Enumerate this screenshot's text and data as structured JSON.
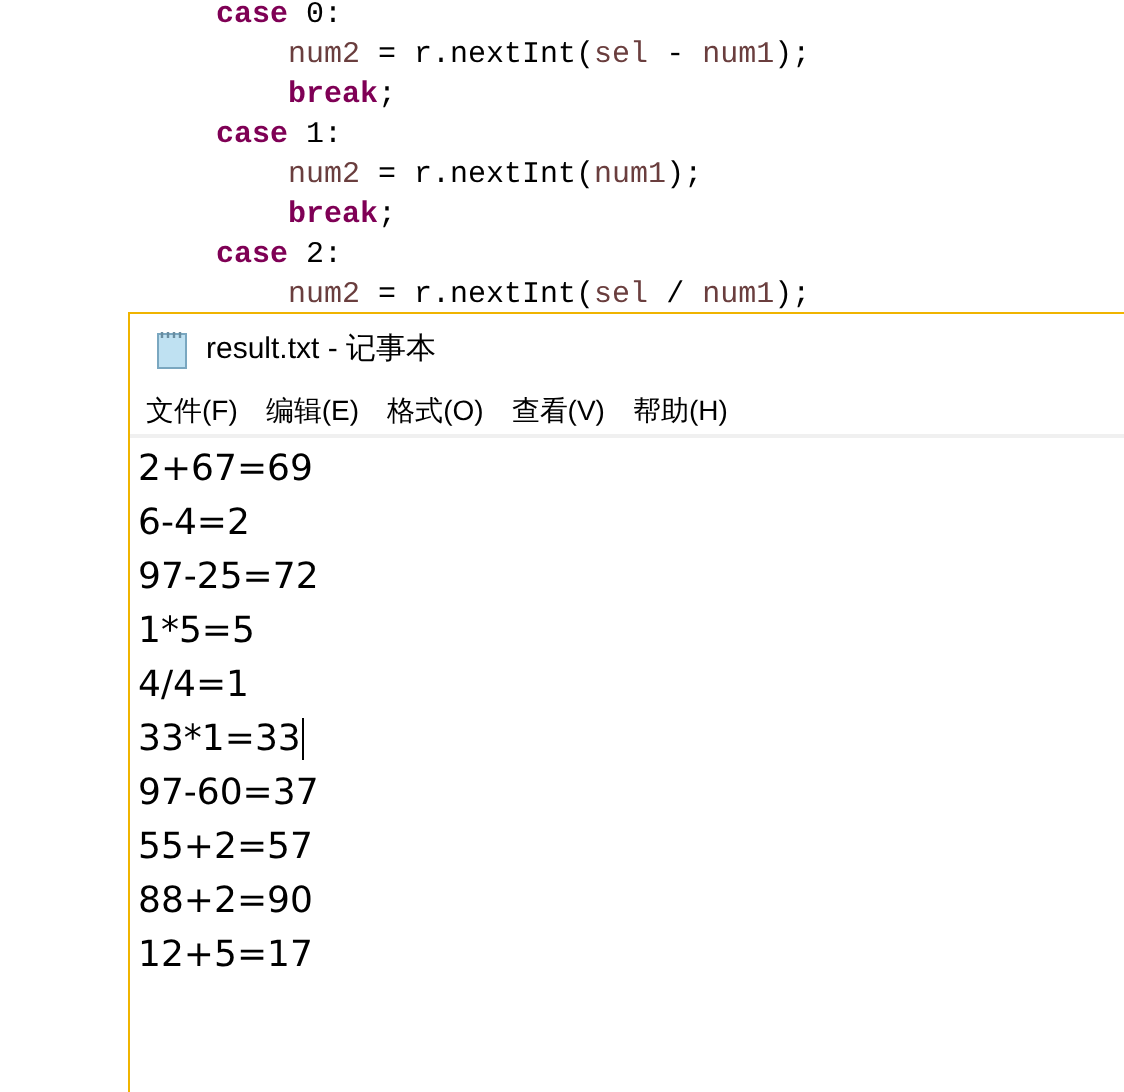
{
  "code": {
    "lines": [
      {
        "kind": "label",
        "tokens": [
          {
            "kind": "keyword",
            "text": "case"
          },
          {
            "kind": "plain",
            "text": " 0:"
          }
        ]
      },
      {
        "kind": "body",
        "tokens": [
          {
            "kind": "var",
            "text": "num2"
          },
          {
            "kind": "plain",
            "text": " = r.nextInt("
          },
          {
            "kind": "var",
            "text": "sel"
          },
          {
            "kind": "plain",
            "text": " - "
          },
          {
            "kind": "var",
            "text": "num1"
          },
          {
            "kind": "plain",
            "text": ");"
          }
        ]
      },
      {
        "kind": "body",
        "tokens": [
          {
            "kind": "keyword",
            "text": "break"
          },
          {
            "kind": "plain",
            "text": ";"
          }
        ]
      },
      {
        "kind": "label",
        "tokens": [
          {
            "kind": "keyword",
            "text": "case"
          },
          {
            "kind": "plain",
            "text": " 1:"
          }
        ]
      },
      {
        "kind": "body",
        "tokens": [
          {
            "kind": "var",
            "text": "num2"
          },
          {
            "kind": "plain",
            "text": " = r.nextInt("
          },
          {
            "kind": "var",
            "text": "num1"
          },
          {
            "kind": "plain",
            "text": ");"
          }
        ]
      },
      {
        "kind": "body",
        "tokens": [
          {
            "kind": "keyword",
            "text": "break"
          },
          {
            "kind": "plain",
            "text": ";"
          }
        ]
      },
      {
        "kind": "label",
        "tokens": [
          {
            "kind": "keyword",
            "text": "case"
          },
          {
            "kind": "plain",
            "text": " 2:"
          }
        ]
      },
      {
        "kind": "body",
        "tokens": [
          {
            "kind": "var",
            "text": "num2"
          },
          {
            "kind": "plain",
            "text": " = r.nextInt("
          },
          {
            "kind": "var",
            "text": "sel"
          },
          {
            "kind": "plain",
            "text": " / "
          },
          {
            "kind": "var",
            "text": "num1"
          },
          {
            "kind": "plain",
            "text": ");"
          }
        ]
      }
    ]
  },
  "notepad": {
    "title": "result.txt - 记事本",
    "menu": [
      "文件(F)",
      "编辑(E)",
      "格式(O)",
      "查看(V)",
      "帮助(H)"
    ],
    "lines": [
      {
        "text": "2+67=69",
        "caret": false
      },
      {
        "text": "6-4=2",
        "caret": false
      },
      {
        "text": "97-25=72",
        "caret": false
      },
      {
        "text": "1*5=5",
        "caret": false
      },
      {
        "text": "4/4=1",
        "caret": false
      },
      {
        "text": "33*1=33",
        "caret": true
      },
      {
        "text": "97-60=37",
        "caret": false
      },
      {
        "text": "55+2=57",
        "caret": false
      },
      {
        "text": "88+2=90",
        "caret": false
      },
      {
        "text": "12+5=17",
        "caret": false
      }
    ]
  }
}
